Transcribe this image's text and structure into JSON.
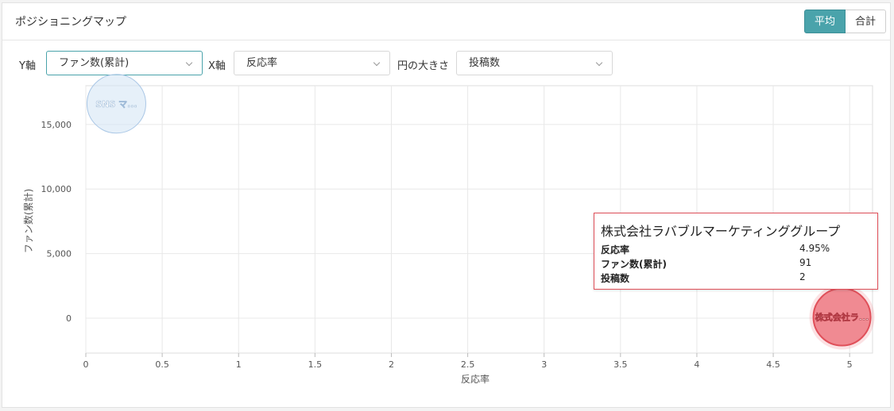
{
  "panel": {
    "title": "ポジショニングマップ",
    "toggle": {
      "average": "平均",
      "total": "合計",
      "active": "average"
    }
  },
  "controls": {
    "y_axis_label": "Y軸",
    "y_axis_value": "ファン数(累計)",
    "x_axis_label": "X軸",
    "x_axis_value": "反応率",
    "size_label": "円の大きさ",
    "size_value": "投稿数"
  },
  "chart_data": {
    "type": "scatter",
    "xlabel": "反応率",
    "ylabel": "ファン数(累計)",
    "xlim": [
      0,
      5.15
    ],
    "ylim": [
      -2700,
      18000
    ],
    "x_ticks": [
      0,
      0.5,
      1,
      1.5,
      2,
      2.5,
      3,
      3.5,
      4,
      4.5,
      5
    ],
    "x_tick_labels": [
      "0",
      "0.5",
      "1",
      "1.5",
      "2",
      "2.5",
      "3",
      "3.5",
      "4",
      "4.5",
      "5"
    ],
    "y_ticks": [
      0,
      5000,
      10000,
      15000
    ],
    "y_tick_labels": [
      "0",
      "5,000",
      "10,000",
      "15,000"
    ],
    "grid": true,
    "points": [
      {
        "label": "SNS マ...",
        "x": 0.2,
        "y": 16600,
        "color": "#d6e6f5",
        "stroke": "#aac7e6",
        "highlight": false
      },
      {
        "label": "株式会社ラ...",
        "x": 4.95,
        "y": 91,
        "color": "#f08a92",
        "stroke": "#e0505a",
        "highlight": true
      }
    ]
  },
  "tooltip": {
    "title": "株式会社ラバブルマーケティンググループ",
    "rows": [
      {
        "key": "反応率",
        "value": "4.95%"
      },
      {
        "key": "ファン数(累計)",
        "value": "91"
      },
      {
        "key": "投稿数",
        "value": "2"
      }
    ]
  },
  "colors": {
    "accent": "#4aa3ab",
    "highlight_point": "#f08a92",
    "muted_point": "#d6e6f5"
  }
}
